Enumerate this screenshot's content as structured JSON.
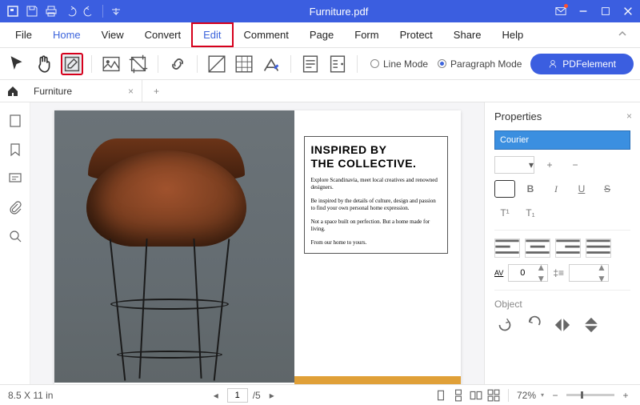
{
  "titlebar": {
    "title": "Furniture.pdf"
  },
  "menu": {
    "file": "File",
    "home": "Home",
    "view": "View",
    "convert": "Convert",
    "edit": "Edit",
    "comment": "Comment",
    "page": "Page",
    "form": "Form",
    "protect": "Protect",
    "share": "Share",
    "help": "Help"
  },
  "toolbar": {
    "line_mode": "Line Mode",
    "paragraph_mode": "Paragraph Mode",
    "brand_button": "PDFelement"
  },
  "tabs": {
    "tab1": "Furniture"
  },
  "document": {
    "heading1": "INSPIRED BY",
    "heading2": "THE COLLECTIVE.",
    "p1": "Explore Scandinavia, meet local creatives and renowned designers.",
    "p2": "Be inspired by the details of culture, design and passion to find your own personal home expression.",
    "p3": "Not a space built on perfection. But a home made for living.",
    "p4": "From our home to yours."
  },
  "properties": {
    "title": "Properties",
    "font": "Courier",
    "bold": "B",
    "italic": "I",
    "underline": "U",
    "strike": "S",
    "superscript": "T¹",
    "subscript": "T₁",
    "spacing_label": "AV",
    "spacing_value": "0",
    "object_title": "Object"
  },
  "status": {
    "dimensions": "8.5 X 11 in",
    "page_current": "1",
    "page_total": "/5",
    "zoom": "72%"
  }
}
